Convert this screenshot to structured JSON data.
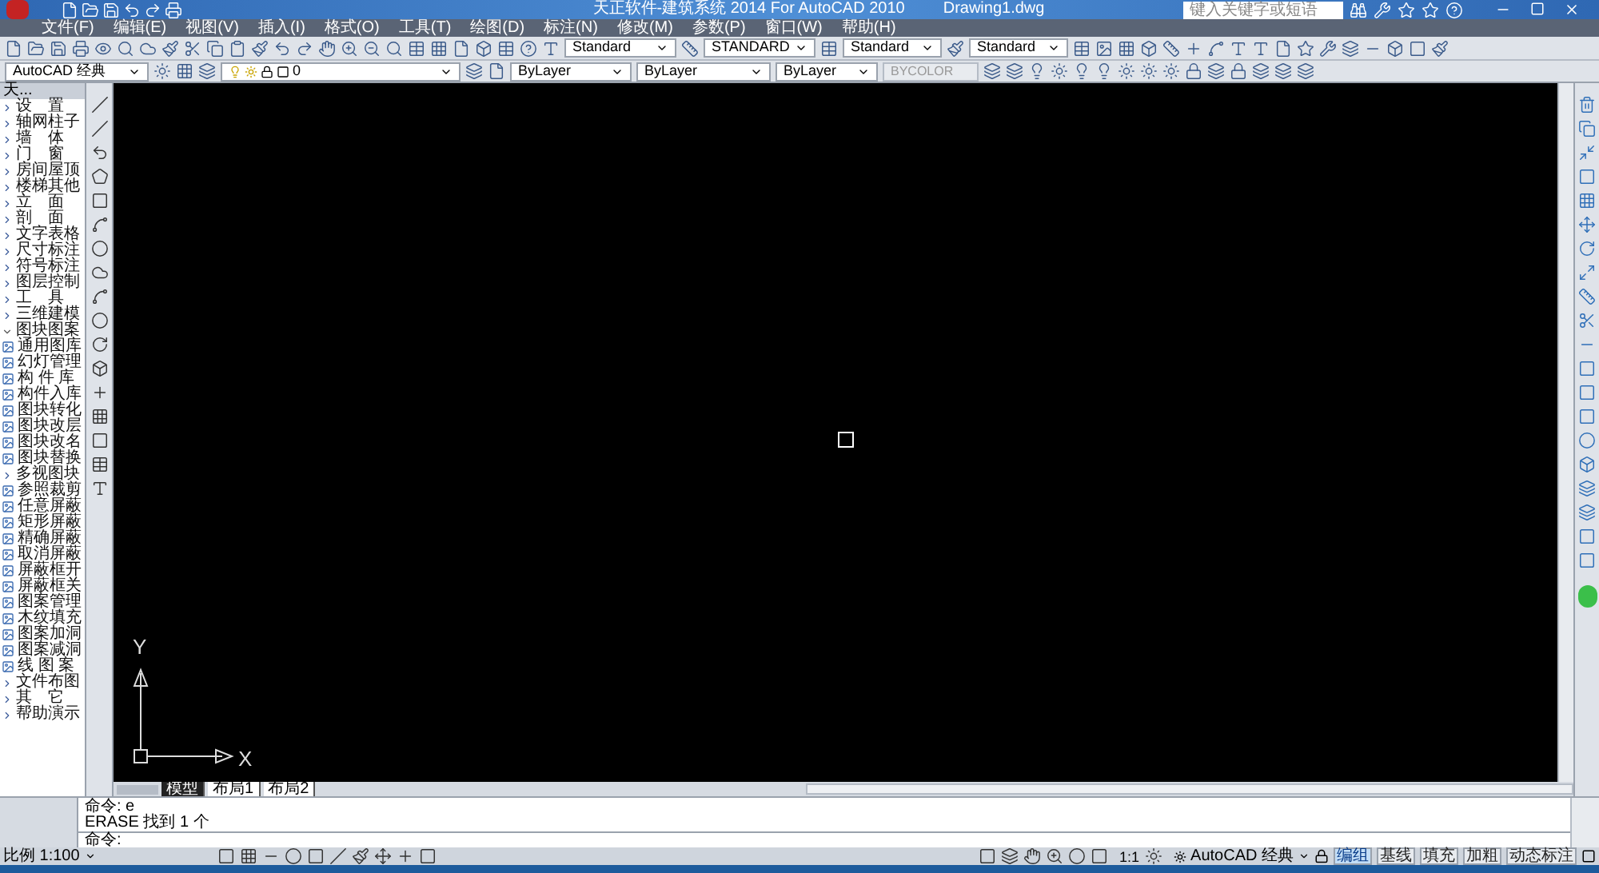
{
  "window": {
    "title": "天正软件-建筑系统 2014  For AutoCAD 2010",
    "document": "Drawing1.dwg",
    "search_placeholder": "键入关键字或短语"
  },
  "menu": [
    "文件(F)",
    "编辑(E)",
    "视图(V)",
    "插入(I)",
    "格式(O)",
    "工具(T)",
    "绘图(D)",
    "标注(N)",
    "修改(M)",
    "参数(P)",
    "窗口(W)",
    "帮助(H)"
  ],
  "toolbar_1": {
    "text_style": "Standard",
    "dim_style": "STANDARD",
    "table_style": "Standard",
    "multileader_style": "Standard"
  },
  "toolbar_2": {
    "workspace": "AutoCAD 经典",
    "layer": "0",
    "color_setting": "ByLayer",
    "linetype": "ByLayer",
    "lineweight": "ByLayer",
    "plot_style": "BYCOLOR"
  },
  "palette": {
    "title": "天...",
    "items": [
      {
        "label": "设　置",
        "kind": "group",
        "expanded": false
      },
      {
        "label": "轴网柱子",
        "kind": "group",
        "expanded": false
      },
      {
        "label": "墙　体",
        "kind": "group",
        "expanded": false
      },
      {
        "label": "门　窗",
        "kind": "group",
        "expanded": false
      },
      {
        "label": "房间屋顶",
        "kind": "group",
        "expanded": false
      },
      {
        "label": "楼梯其他",
        "kind": "group",
        "expanded": false
      },
      {
        "label": "立　面",
        "kind": "group",
        "expanded": false
      },
      {
        "label": "剖　面",
        "kind": "group",
        "expanded": false
      },
      {
        "label": "文字表格",
        "kind": "group",
        "expanded": false
      },
      {
        "label": "尺寸标注",
        "kind": "group",
        "expanded": false
      },
      {
        "label": "符号标注",
        "kind": "group",
        "expanded": false
      },
      {
        "label": "图层控制",
        "kind": "group",
        "expanded": false
      },
      {
        "label": "工　具",
        "kind": "group",
        "expanded": false
      },
      {
        "label": "三维建模",
        "kind": "group",
        "expanded": false
      },
      {
        "label": "图块图案",
        "kind": "group",
        "expanded": true,
        "children": [
          {
            "label": "通用图库",
            "kind": "tool"
          },
          {
            "label": "幻灯管理",
            "kind": "tool"
          },
          {
            "label": "构 件 库",
            "kind": "tool"
          },
          {
            "label": "构件入库",
            "kind": "tool"
          },
          {
            "label": "图块转化",
            "kind": "tool"
          },
          {
            "label": "图块改层",
            "kind": "tool"
          },
          {
            "label": "图块改名",
            "kind": "tool"
          },
          {
            "label": "图块替换",
            "kind": "tool"
          },
          {
            "label": "多视图块",
            "kind": "group",
            "expanded": false
          },
          {
            "label": "参照裁剪",
            "kind": "tool"
          },
          {
            "label": "任意屏蔽",
            "kind": "tool"
          },
          {
            "label": "矩形屏蔽",
            "kind": "tool"
          },
          {
            "label": "精确屏蔽",
            "kind": "tool"
          },
          {
            "label": "取消屏蔽",
            "kind": "tool"
          },
          {
            "label": "屏蔽框开",
            "kind": "tool"
          },
          {
            "label": "屏蔽框关",
            "kind": "tool"
          },
          {
            "label": "图案管理",
            "kind": "tool"
          },
          {
            "label": "木纹填充",
            "kind": "tool"
          },
          {
            "label": "图案加洞",
            "kind": "tool"
          },
          {
            "label": "图案减洞",
            "kind": "tool"
          },
          {
            "label": "线 图 案",
            "kind": "tool"
          }
        ]
      },
      {
        "label": "文件布图",
        "kind": "group",
        "expanded": false
      },
      {
        "label": "其　它",
        "kind": "group",
        "expanded": false
      },
      {
        "label": "帮助演示",
        "kind": "group",
        "expanded": false
      }
    ]
  },
  "canvas": {
    "ucs_x": "X",
    "ucs_y": "Y"
  },
  "layout_tabs": [
    {
      "label": "模型",
      "selected": true
    },
    {
      "label": "布局1",
      "selected": false
    },
    {
      "label": "布局2",
      "selected": false
    }
  ],
  "command_history": [
    "命令: e",
    "ERASE 找到 1 个"
  ],
  "command_prompt": "命令:",
  "status_bar": {
    "scale": "比例 1:100",
    "annotation_scale": "1:1",
    "workspace": "AutoCAD 经典",
    "toggles": [
      {
        "label": "编组",
        "on": true
      },
      {
        "label": "基线",
        "on": false
      },
      {
        "label": "填充",
        "on": false
      },
      {
        "label": "加粗",
        "on": false
      },
      {
        "label": "动态标注",
        "on": false
      }
    ]
  }
}
